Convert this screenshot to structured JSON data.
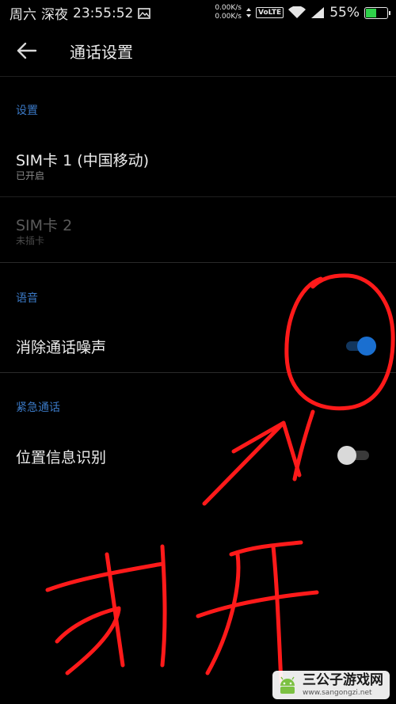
{
  "statusbar": {
    "day": "周六",
    "period": "深夜",
    "time": "23:55:52",
    "net_up": "0.00K/s",
    "net_down": "0.00K/s",
    "volte": "VoLTE",
    "battery": "55%",
    "battery_level": 0.55
  },
  "appbar": {
    "title": "通话设置"
  },
  "sections": {
    "settings": {
      "header": "设置",
      "sim1": {
        "title": "SIM卡 1 (中国移动)",
        "status": "已开启"
      },
      "sim2": {
        "title": "SIM卡 2",
        "status": "未插卡"
      }
    },
    "voice": {
      "header": "语音",
      "noise": {
        "title": "消除通话噪声",
        "enabled": true
      }
    },
    "emergency": {
      "header": "紧急通话",
      "location": {
        "title": "位置信息识别",
        "enabled": false
      }
    }
  },
  "annotation": {
    "text": "打开"
  },
  "watermark": {
    "title": "三公子游戏网",
    "url": "www.sangongzi.net"
  },
  "colors": {
    "accent": "#1a6fd0",
    "section_header": "#3a78c4",
    "annotation": "#ff1a1a",
    "background": "#000000"
  }
}
